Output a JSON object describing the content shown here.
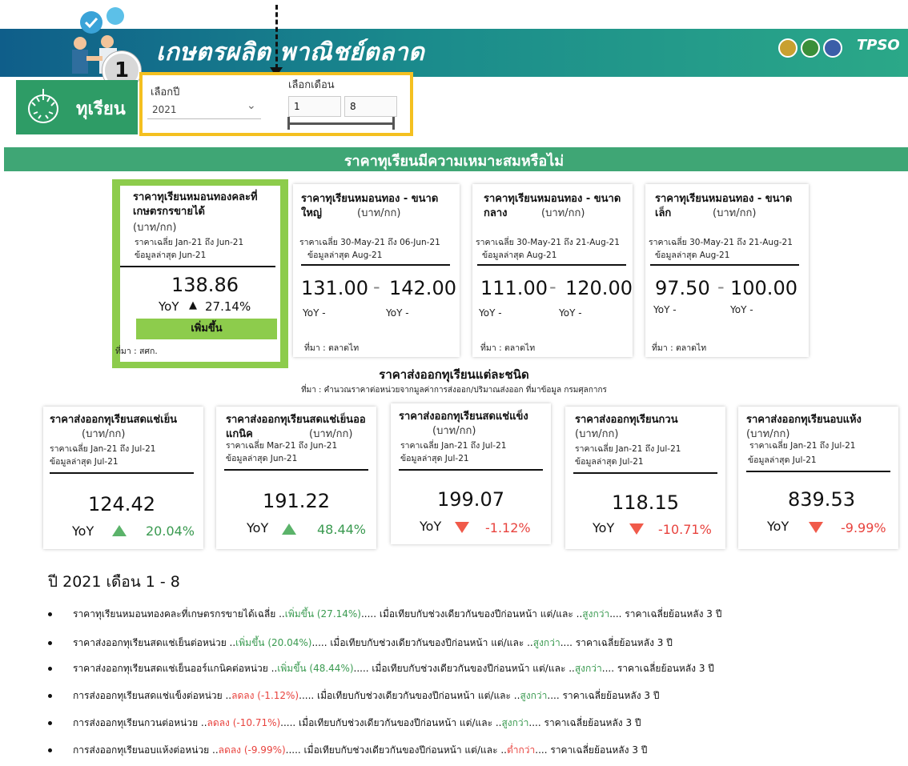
{
  "header": {
    "title": "เกษตรผลิต พาณิชย์ตลาด",
    "logo_text": "TPSO",
    "callout_number": "1"
  },
  "product": {
    "label": "ทุเรียน"
  },
  "filters": {
    "year_label": "เลือกปี",
    "year_value": "2021",
    "month_label": "เลือกเดือน",
    "month_from": "1",
    "month_to": "8"
  },
  "section_heading": "ราคาทุเรียนมีความเหมาะสมหรือไม่",
  "price_cards": [
    {
      "title": "ราคาทุเรียนหมอนทองคละที่เกษตรกรขายได้",
      "unit": "(บาท/กก)",
      "period": "ราคาเฉลี่ย Jan-21 ถึง Jun-21",
      "latest": "ข้อมูลล่าสุด Jun-21",
      "value": "138.86",
      "yoy_label": "YoY",
      "yoy_value": "27.14%",
      "status": "เพิ่มขึ้น",
      "source": "ที่มา : สศก."
    },
    {
      "title": "ราคาทุเรียนหมอนทอง - ขนาดใหญ่",
      "unit": "(บาท/กก)",
      "period": "ราคาเฉลี่ย 30-May-21 ถึง 06-Jun-21",
      "latest": "ข้อมูลล่าสุด Aug-21",
      "low": "131.00",
      "high": "142.00",
      "yoy_low": "YoY  -",
      "yoy_high": "YoY  -",
      "source": "ที่มา : ตลาดไท"
    },
    {
      "title": "ราคาทุเรียนหมอนทอง - ขนาดกลาง",
      "unit": "(บาท/กก)",
      "period": "ราคาเฉลี่ย 30-May-21 ถึง 21-Aug-21",
      "latest": "ข้อมูลล่าสุด Aug-21",
      "low": "111.00",
      "high": "120.00",
      "yoy_low": "YoY  -",
      "yoy_high": "YoY  -",
      "source": "ที่มา : ตลาดไท"
    },
    {
      "title": "ราคาทุเรียนหมอนทอง - ขนาดเล็ก",
      "unit": "(บาท/กก)",
      "period": "ราคาเฉลี่ย 30-May-21 ถึง 21-Aug-21",
      "latest": "ข้อมูลล่าสุด Aug-21",
      "low": "97.50",
      "high": "100.00",
      "yoy_low": "YoY  -",
      "yoy_high": "YoY  -",
      "source": "ที่มา : ตลาดไท"
    }
  ],
  "export_section": {
    "title": "ราคาส่งออกทุเรียนแต่ละชนิด",
    "source": "ที่มา : คำนวณราคาต่อหน่วยจากมูลค่าการส่งออก/ปริมาณส่งออก ที่มาข้อมูล กรมศุลกากร"
  },
  "export_cards": [
    {
      "title": "ราคาส่งออกทุเรียนสดแช่เย็น",
      "unit": "(บาท/กก)",
      "period": "ราคาเฉลี่ย Jan-21 ถึง Jul-21",
      "latest": "ข้อมูลล่าสุด Jul-21",
      "value": "124.42",
      "yoy_label": "YoY",
      "yoy_value": "20.04%",
      "direction": "up"
    },
    {
      "title": "ราคาส่งออกทุเรียนสดแช่เย็นออแกนิค",
      "unit": "(บาท/กก)",
      "period": "ราคาเฉลี่ย Mar-21 ถึง Jun-21",
      "latest": "ข้อมูลล่าสุด Jun-21",
      "value": "191.22",
      "yoy_label": "YoY",
      "yoy_value": "48.44%",
      "direction": "up"
    },
    {
      "title": "ราคาส่งออกทุเรียนสดแช่แข็ง",
      "unit": "(บาท/กก)",
      "period": "ราคาเฉลี่ย Jan-21 ถึง Jul-21",
      "latest": "ข้อมูลล่าสุด Jul-21",
      "value": "199.07",
      "yoy_label": "YoY",
      "yoy_value": "-1.12%",
      "direction": "down"
    },
    {
      "title": "ราคาส่งออกทุเรียนกวน",
      "unit": "(บาท/กก)",
      "period": "ราคาเฉลี่ย Jan-21 ถึง Jul-21",
      "latest": "ข้อมูลล่าสุด Jul-21",
      "value": "118.15",
      "yoy_label": "YoY",
      "yoy_value": "-10.71%",
      "direction": "down"
    },
    {
      "title": "ราคาส่งออกทุเรียนอบแห้ง",
      "unit": "(บาท/กก)",
      "period": "ราคาเฉลี่ย Jan-21 ถึง Jul-21",
      "latest": "ข้อมูลล่าสุด Jul-21",
      "value": "839.53",
      "yoy_label": "YoY",
      "yoy_value": "-9.99%",
      "direction": "down"
    }
  ],
  "summary": {
    "title": "ปี 2021  เดือน   1 - 8",
    "compare_text": "เมื่อเทียบกับช่วงเดียวกันของปีก่อนหน้า แต่/และ",
    "suffix": "ราคาเฉลี่ยย้อนหลัง 3 ปี",
    "rows": [
      {
        "prefix": "ราคาทุเรียนหมอนทองคละที่เกษตรกรขายได้เฉลี่ย",
        "change": "เพิ่มขึ้น  (27.14%)",
        "change_dir": "up",
        "vs3y": "สูงกว่า",
        "vs3y_dir": "up"
      },
      {
        "prefix": "ราคาส่งออกทุเรียนสดแช่เย็นต่อหน่วย",
        "change": "เพิ่มขึ้น  (20.04%)",
        "change_dir": "up",
        "vs3y": "สูงกว่า",
        "vs3y_dir": "up"
      },
      {
        "prefix": "ราคาส่งออกทุเรียนสดแช่เย็นออร์แกนิคต่อหน่วย",
        "change": "เพิ่มขึ้น  (48.44%)",
        "change_dir": "up",
        "vs3y": "สูงกว่า",
        "vs3y_dir": "up"
      },
      {
        "prefix": "การส่งออกทุเรียนสดแช่แข็งต่อหน่วย",
        "change": "ลดลง  (-1.12%)",
        "change_dir": "down",
        "vs3y": "สูงกว่า",
        "vs3y_dir": "up"
      },
      {
        "prefix": "การส่งออกทุเรียนกวนต่อหน่วย",
        "change": "ลดลง  (-10.71%)",
        "change_dir": "down",
        "vs3y": "สูงกว่า",
        "vs3y_dir": "up"
      },
      {
        "prefix": "การส่งออกทุเรียนอบแห้งต่อหน่วย",
        "change": "ลดลง  (-9.99%)",
        "change_dir": "down",
        "vs3y": "ต่ำกว่า",
        "vs3y_dir": "down"
      }
    ]
  },
  "colors": {
    "banner_start": "#0f5e8a",
    "banner_end": "#2ba888",
    "heading_green": "#3fa675",
    "highlight_green": "#8dcc4c",
    "filter_border": "#f4c020",
    "up": "#3a9a50",
    "down": "#e8433e"
  }
}
